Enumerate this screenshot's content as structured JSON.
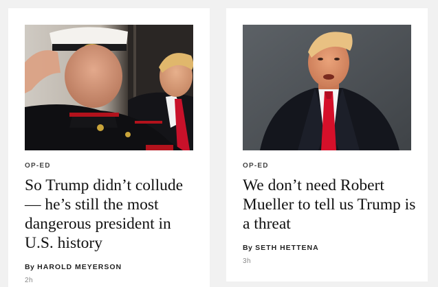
{
  "cards": [
    {
      "section": "OP-ED",
      "headline": "So Trump didn’t collude — he’s still the most dangerous president in U.S. history",
      "byline_prefix": "By",
      "author": "HAROLD MEYERSON",
      "age": "2h",
      "image_alt": "photo-saluting-marine-and-trump"
    },
    {
      "section": "OP-ED",
      "headline": "We don’t need Robert Mueller to tell us Trump is a threat",
      "byline_prefix": "By",
      "author": "SETH HETTENA",
      "age": "3h",
      "image_alt": "photo-trump-portrait"
    }
  ]
}
